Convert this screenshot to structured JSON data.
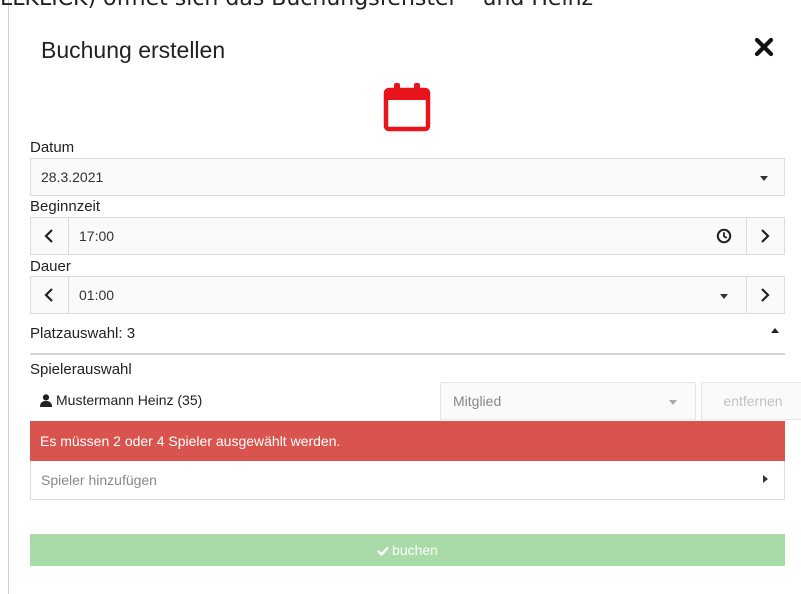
{
  "background": {
    "caption_fragment": "LLKLICK) öffnet sich das Buchungsfenster – und Heinz"
  },
  "dialog": {
    "title": "Buchung erstellen",
    "accent_color": "#e8141b"
  },
  "datum": {
    "label": "Datum",
    "value": "28.3.2021"
  },
  "beginnzeit": {
    "label": "Beginnzeit",
    "value": "17:00"
  },
  "dauer": {
    "label": "Dauer",
    "value": "01:00"
  },
  "platzauswahl": {
    "label": "Platzauswahl: 3"
  },
  "spielerauswahl": {
    "label": "Spielerauswahl",
    "players": [
      {
        "name": "Mustermann Heinz (35)",
        "type": "Mitglied",
        "remove_label": "entfernen"
      }
    ],
    "error": "Es müssen 2 oder 4 Spieler ausgewählt werden.",
    "add_label": "Spieler hinzufügen"
  },
  "actions": {
    "book_label": "buchen",
    "book_color": "#a9dba9",
    "error_color": "#d9534f"
  }
}
